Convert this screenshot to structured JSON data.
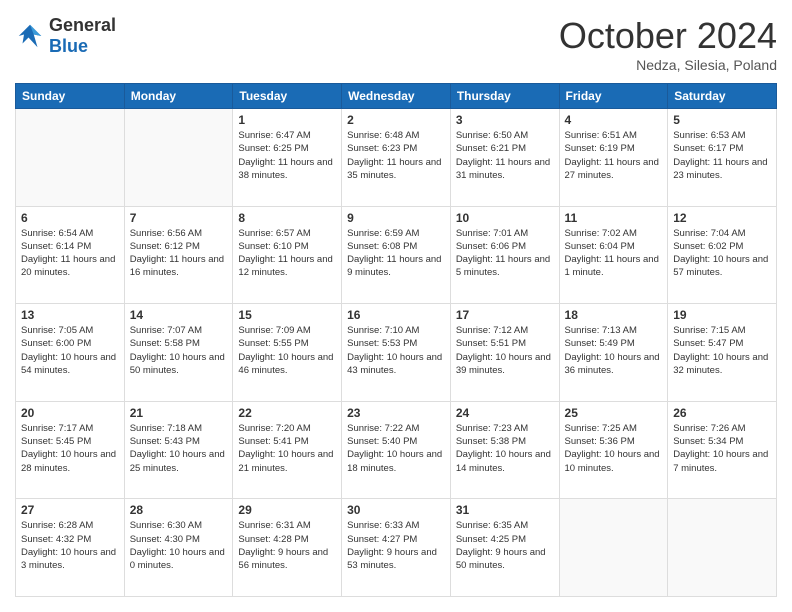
{
  "header": {
    "logo_general": "General",
    "logo_blue": "Blue",
    "month_title": "October 2024",
    "location": "Nedza, Silesia, Poland"
  },
  "days_of_week": [
    "Sunday",
    "Monday",
    "Tuesday",
    "Wednesday",
    "Thursday",
    "Friday",
    "Saturday"
  ],
  "weeks": [
    [
      {
        "day": "",
        "empty": true
      },
      {
        "day": "",
        "empty": true
      },
      {
        "day": "1",
        "sunrise": "Sunrise: 6:47 AM",
        "sunset": "Sunset: 6:25 PM",
        "daylight": "Daylight: 11 hours and 38 minutes."
      },
      {
        "day": "2",
        "sunrise": "Sunrise: 6:48 AM",
        "sunset": "Sunset: 6:23 PM",
        "daylight": "Daylight: 11 hours and 35 minutes."
      },
      {
        "day": "3",
        "sunrise": "Sunrise: 6:50 AM",
        "sunset": "Sunset: 6:21 PM",
        "daylight": "Daylight: 11 hours and 31 minutes."
      },
      {
        "day": "4",
        "sunrise": "Sunrise: 6:51 AM",
        "sunset": "Sunset: 6:19 PM",
        "daylight": "Daylight: 11 hours and 27 minutes."
      },
      {
        "day": "5",
        "sunrise": "Sunrise: 6:53 AM",
        "sunset": "Sunset: 6:17 PM",
        "daylight": "Daylight: 11 hours and 23 minutes."
      }
    ],
    [
      {
        "day": "6",
        "sunrise": "Sunrise: 6:54 AM",
        "sunset": "Sunset: 6:14 PM",
        "daylight": "Daylight: 11 hours and 20 minutes."
      },
      {
        "day": "7",
        "sunrise": "Sunrise: 6:56 AM",
        "sunset": "Sunset: 6:12 PM",
        "daylight": "Daylight: 11 hours and 16 minutes."
      },
      {
        "day": "8",
        "sunrise": "Sunrise: 6:57 AM",
        "sunset": "Sunset: 6:10 PM",
        "daylight": "Daylight: 11 hours and 12 minutes."
      },
      {
        "day": "9",
        "sunrise": "Sunrise: 6:59 AM",
        "sunset": "Sunset: 6:08 PM",
        "daylight": "Daylight: 11 hours and 9 minutes."
      },
      {
        "day": "10",
        "sunrise": "Sunrise: 7:01 AM",
        "sunset": "Sunset: 6:06 PM",
        "daylight": "Daylight: 11 hours and 5 minutes."
      },
      {
        "day": "11",
        "sunrise": "Sunrise: 7:02 AM",
        "sunset": "Sunset: 6:04 PM",
        "daylight": "Daylight: 11 hours and 1 minute."
      },
      {
        "day": "12",
        "sunrise": "Sunrise: 7:04 AM",
        "sunset": "Sunset: 6:02 PM",
        "daylight": "Daylight: 10 hours and 57 minutes."
      }
    ],
    [
      {
        "day": "13",
        "sunrise": "Sunrise: 7:05 AM",
        "sunset": "Sunset: 6:00 PM",
        "daylight": "Daylight: 10 hours and 54 minutes."
      },
      {
        "day": "14",
        "sunrise": "Sunrise: 7:07 AM",
        "sunset": "Sunset: 5:58 PM",
        "daylight": "Daylight: 10 hours and 50 minutes."
      },
      {
        "day": "15",
        "sunrise": "Sunrise: 7:09 AM",
        "sunset": "Sunset: 5:55 PM",
        "daylight": "Daylight: 10 hours and 46 minutes."
      },
      {
        "day": "16",
        "sunrise": "Sunrise: 7:10 AM",
        "sunset": "Sunset: 5:53 PM",
        "daylight": "Daylight: 10 hours and 43 minutes."
      },
      {
        "day": "17",
        "sunrise": "Sunrise: 7:12 AM",
        "sunset": "Sunset: 5:51 PM",
        "daylight": "Daylight: 10 hours and 39 minutes."
      },
      {
        "day": "18",
        "sunrise": "Sunrise: 7:13 AM",
        "sunset": "Sunset: 5:49 PM",
        "daylight": "Daylight: 10 hours and 36 minutes."
      },
      {
        "day": "19",
        "sunrise": "Sunrise: 7:15 AM",
        "sunset": "Sunset: 5:47 PM",
        "daylight": "Daylight: 10 hours and 32 minutes."
      }
    ],
    [
      {
        "day": "20",
        "sunrise": "Sunrise: 7:17 AM",
        "sunset": "Sunset: 5:45 PM",
        "daylight": "Daylight: 10 hours and 28 minutes."
      },
      {
        "day": "21",
        "sunrise": "Sunrise: 7:18 AM",
        "sunset": "Sunset: 5:43 PM",
        "daylight": "Daylight: 10 hours and 25 minutes."
      },
      {
        "day": "22",
        "sunrise": "Sunrise: 7:20 AM",
        "sunset": "Sunset: 5:41 PM",
        "daylight": "Daylight: 10 hours and 21 minutes."
      },
      {
        "day": "23",
        "sunrise": "Sunrise: 7:22 AM",
        "sunset": "Sunset: 5:40 PM",
        "daylight": "Daylight: 10 hours and 18 minutes."
      },
      {
        "day": "24",
        "sunrise": "Sunrise: 7:23 AM",
        "sunset": "Sunset: 5:38 PM",
        "daylight": "Daylight: 10 hours and 14 minutes."
      },
      {
        "day": "25",
        "sunrise": "Sunrise: 7:25 AM",
        "sunset": "Sunset: 5:36 PM",
        "daylight": "Daylight: 10 hours and 10 minutes."
      },
      {
        "day": "26",
        "sunrise": "Sunrise: 7:26 AM",
        "sunset": "Sunset: 5:34 PM",
        "daylight": "Daylight: 10 hours and 7 minutes."
      }
    ],
    [
      {
        "day": "27",
        "sunrise": "Sunrise: 6:28 AM",
        "sunset": "Sunset: 4:32 PM",
        "daylight": "Daylight: 10 hours and 3 minutes."
      },
      {
        "day": "28",
        "sunrise": "Sunrise: 6:30 AM",
        "sunset": "Sunset: 4:30 PM",
        "daylight": "Daylight: 10 hours and 0 minutes."
      },
      {
        "day": "29",
        "sunrise": "Sunrise: 6:31 AM",
        "sunset": "Sunset: 4:28 PM",
        "daylight": "Daylight: 9 hours and 56 minutes."
      },
      {
        "day": "30",
        "sunrise": "Sunrise: 6:33 AM",
        "sunset": "Sunset: 4:27 PM",
        "daylight": "Daylight: 9 hours and 53 minutes."
      },
      {
        "day": "31",
        "sunrise": "Sunrise: 6:35 AM",
        "sunset": "Sunset: 4:25 PM",
        "daylight": "Daylight: 9 hours and 50 minutes."
      },
      {
        "day": "",
        "empty": true
      },
      {
        "day": "",
        "empty": true
      }
    ]
  ]
}
